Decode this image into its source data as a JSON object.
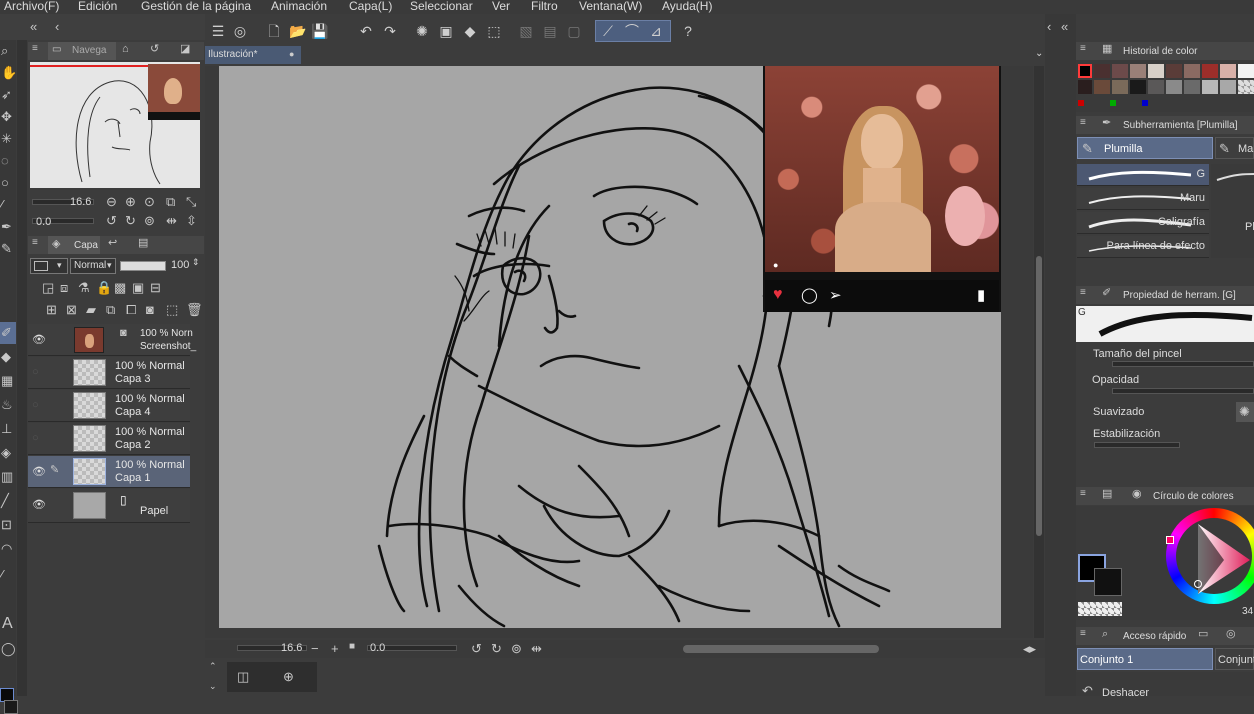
{
  "menu": [
    "Archivo(F)",
    "Edición",
    "Gestión de la página",
    "Animación",
    "Capa(L)",
    "Seleccionar",
    "Ver",
    "Filtro",
    "Ventana(W)",
    "Ayuda(H)"
  ],
  "navigator": {
    "tab_label": "Navega",
    "zoom": "16.6",
    "rotation": "0.0"
  },
  "layers": {
    "tab_label": "Capa",
    "blend_mode": "Normal",
    "opacity": "100",
    "items": [
      {
        "line1": "100 % Norn",
        "line2": "Screenshot_"
      },
      {
        "line1": "100 % Normal",
        "line2": "Capa 3"
      },
      {
        "line1": "100 % Normal",
        "line2": "Capa 4"
      },
      {
        "line1": "100 % Normal",
        "line2": "Capa 2"
      },
      {
        "line1": "100 % Normal",
        "line2": "Capa 1"
      },
      {
        "line1": "",
        "line2": "Papel"
      }
    ]
  },
  "canvas": {
    "tab_label": "Ilustración*",
    "zoom": "16.6",
    "rotation": "0.0"
  },
  "color_history": {
    "title": "Historial de color"
  },
  "subtool": {
    "title": "Subherramienta [Plumilla]",
    "tab_active": "Plumilla",
    "tab_next": "Ma",
    "brushes": [
      "G",
      "Maru",
      "Caligrafía",
      "Para línea de efecto"
    ],
    "brushes_right": [
      "Pl"
    ]
  },
  "tool_property": {
    "title": "Propiedad de herram. [G]",
    "preview_label": "G",
    "props": [
      "Tamaño del pincel",
      "Opacidad",
      "Suavizado",
      "Estabilización"
    ]
  },
  "color_wheel": {
    "title": "Círculo de colores",
    "value": "34"
  },
  "quick_access": {
    "title": "Acceso rápido",
    "sets": [
      "Conjunto 1",
      "Conjunto"
    ],
    "undo_label": "Deshacer"
  },
  "colors": {
    "accent_blue": "#5b6f94",
    "canvas_bg": "#a6a6a6",
    "like_red": "#e8313f"
  }
}
